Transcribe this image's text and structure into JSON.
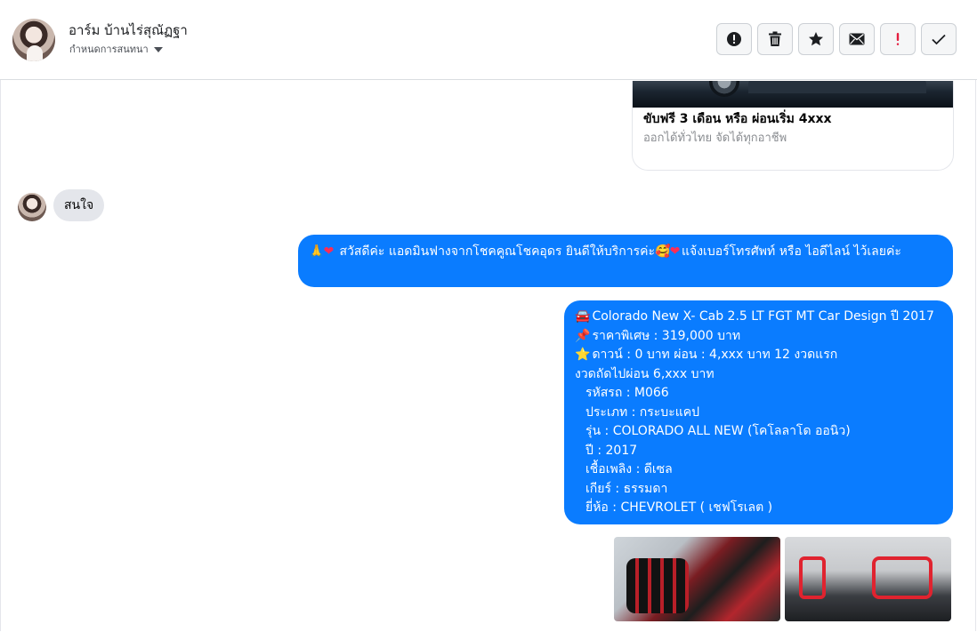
{
  "header": {
    "contact_name": "อาร์ม บ้านไร่สุณัฏฐา",
    "conversation_settings": "กำหนดการสนทนา",
    "toolbar_icons": [
      "alert-circle-icon",
      "trash-icon",
      "star-icon",
      "envelope-icon",
      "exclamation-icon",
      "check-icon"
    ]
  },
  "messages": {
    "card": {
      "title": "ขับฟรี 3 เดือน หรือ ผ่อนเริ่ม 4xxx",
      "subtitle": "ออกได้ทั่วไทย จัดได้ทุกอาชีพ"
    },
    "incoming_1": "สนใจ",
    "outgoing_1": {
      "text_a": "สวัสดีค่ะ แอดมินฟางจากโชคคูณโชคอุดร ยินดีให้บริการค่ะ",
      "text_b": "แจ้งเบอร์โทรศัพท์ หรือ ไอดีไลน์  ไว้เลยค่ะ"
    },
    "outgoing_2": {
      "line1": "Colorado New X- Cab 2.5 LT FGT MT Car Design ปี 2017",
      "line2": "ราคาพิเศษ : 319,000 บาท",
      "line3": "ดาวน์ : 0 บาท ผ่อน : 4,xxx บาท 12 งวดแรก",
      "line4": "งวดถัดไปผ่อน  6,xxx  บาท",
      "line5": "รหัสรถ : M066",
      "line6": "ประเภท : กระบะแคป",
      "line7": "รุ่น : COLORADO ALL NEW (โคโลลาโด ออนิว)",
      "line8": "ปี : 2017",
      "line9": "เชื้อเพลิง : ดีเซล",
      "line10": "เกียร์ : ธรรมดา",
      "line11": "ยี่ห้อ : CHEVROLET ( เชฟโรเลต )"
    }
  },
  "colors": {
    "outgoing_bubble": "#0a7cff",
    "incoming_bubble": "#e4e6eb",
    "exclamation_red": "#e41e3f"
  }
}
